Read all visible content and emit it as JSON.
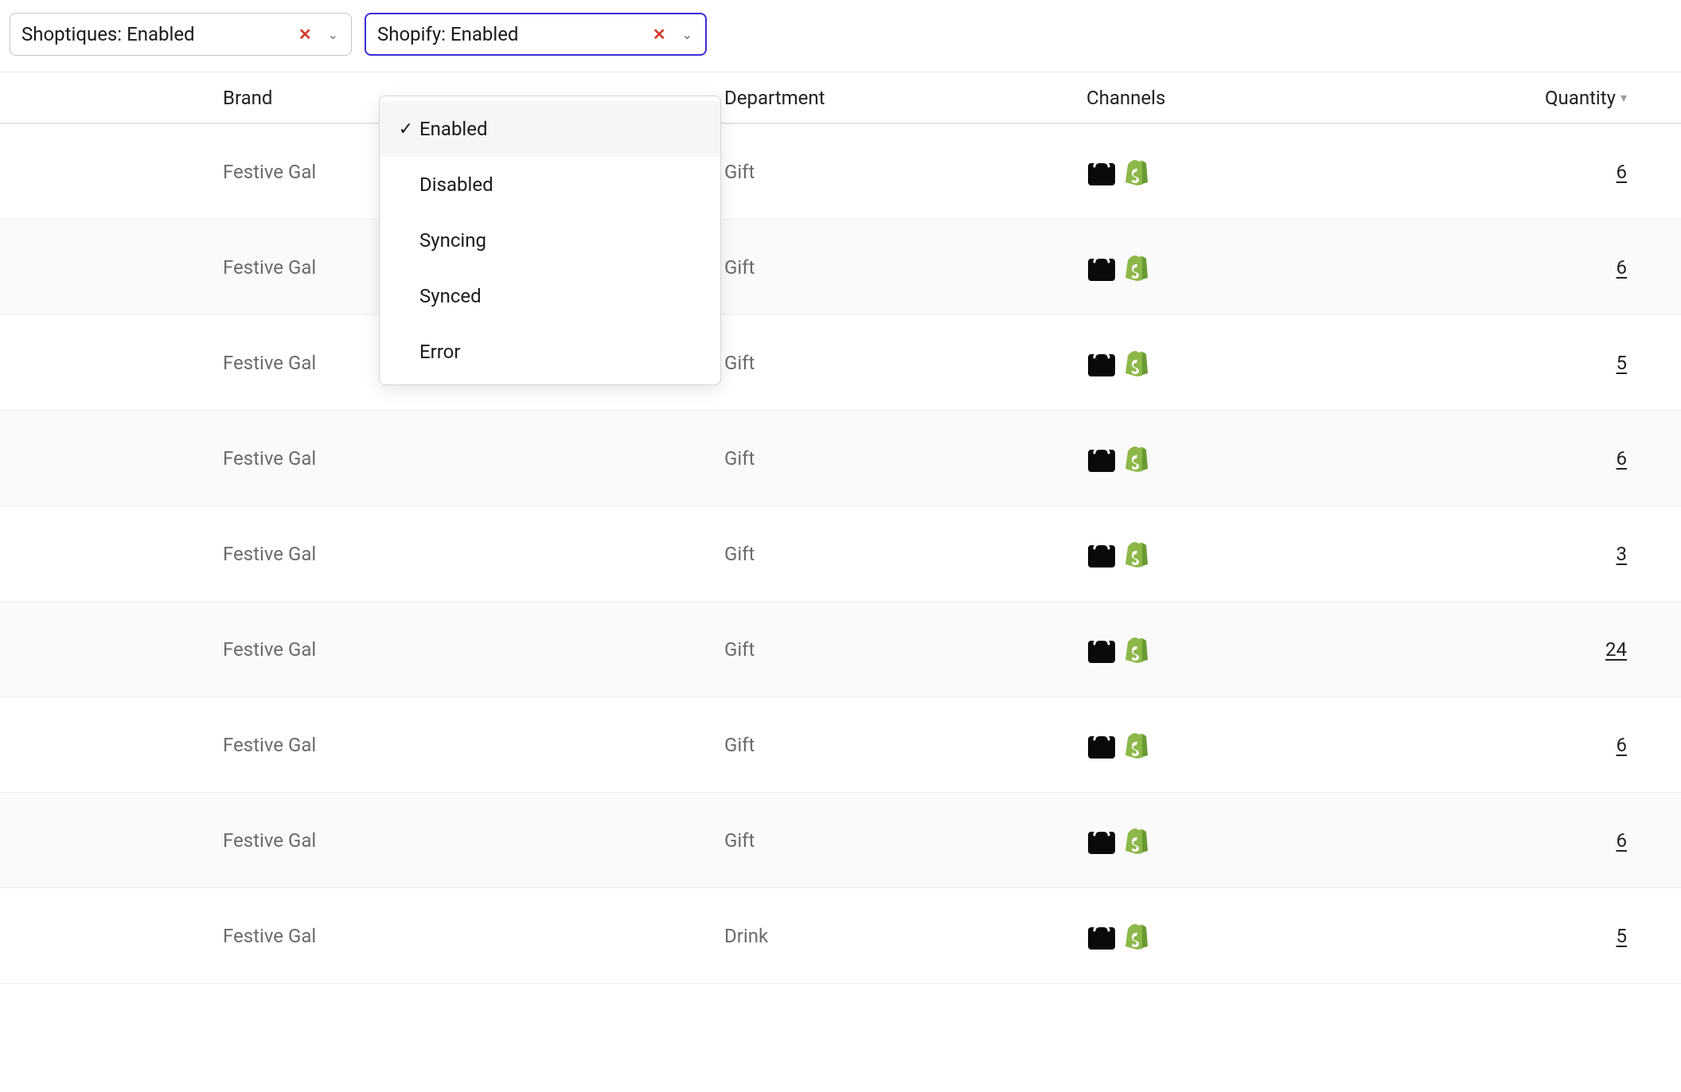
{
  "filters": {
    "shoptiques": {
      "label": "Shoptiques: Enabled"
    },
    "shopify": {
      "label": "Shopify: Enabled"
    }
  },
  "dropdown": {
    "options": [
      {
        "label": "Enabled",
        "selected": true
      },
      {
        "label": "Disabled",
        "selected": false
      },
      {
        "label": "Syncing",
        "selected": false
      },
      {
        "label": "Synced",
        "selected": false
      },
      {
        "label": "Error",
        "selected": false
      }
    ]
  },
  "columns": {
    "brand": "Brand",
    "department": "Department",
    "channels": "Channels",
    "quantity": "Quantity"
  },
  "rows": [
    {
      "brand": "Festive Gal",
      "department": "Gift",
      "quantity": "6"
    },
    {
      "brand": "Festive Gal",
      "department": "Gift",
      "quantity": "6"
    },
    {
      "brand": "Festive Gal",
      "department": "Gift",
      "quantity": "5"
    },
    {
      "brand": "Festive Gal",
      "department": "Gift",
      "quantity": "6"
    },
    {
      "brand": "Festive Gal",
      "department": "Gift",
      "quantity": "3"
    },
    {
      "brand": "Festive Gal",
      "department": "Gift",
      "quantity": "24"
    },
    {
      "brand": "Festive Gal",
      "department": "Gift",
      "quantity": "6"
    },
    {
      "brand": "Festive Gal",
      "department": "Gift",
      "quantity": "6"
    },
    {
      "brand": "Festive Gal",
      "department": "Drink",
      "quantity": "5"
    }
  ],
  "icons": {
    "bag": "shoptiques-bag-icon",
    "shopify": "shopify-icon"
  }
}
